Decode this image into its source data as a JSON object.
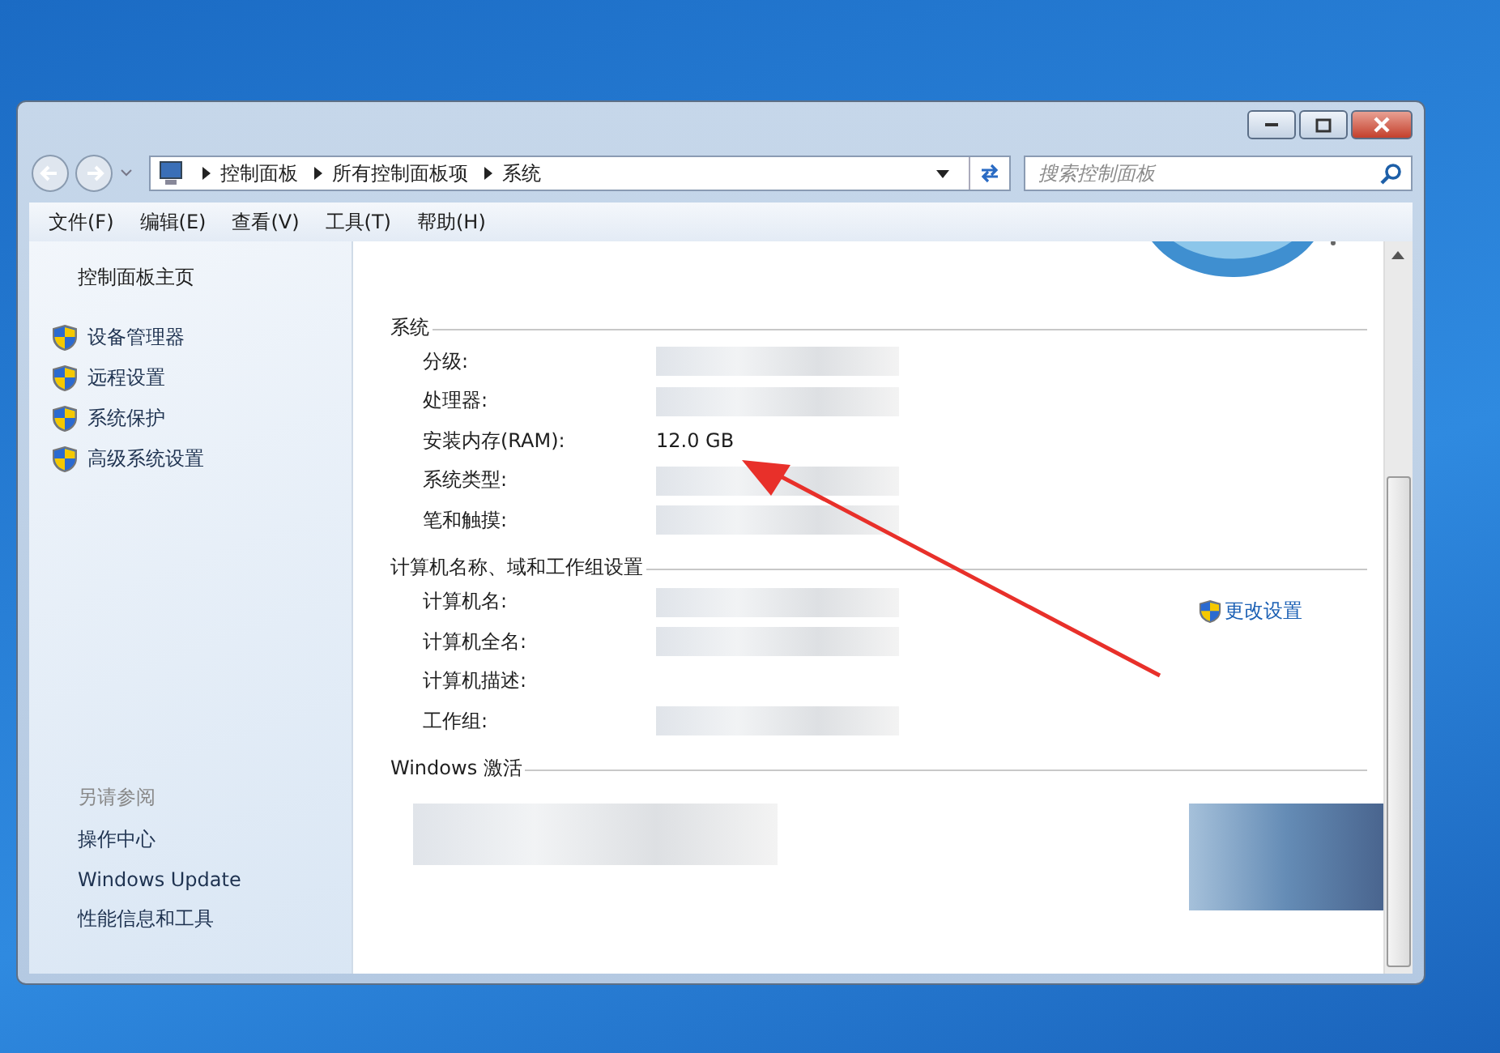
{
  "address": {
    "path": [
      "控制面板",
      "所有控制面板项",
      "系统"
    ]
  },
  "search": {
    "placeholder": "搜索控制面板"
  },
  "menu": [
    "文件(F)",
    "编辑(E)",
    "查看(V)",
    "工具(T)",
    "帮助(H)"
  ],
  "sidebar": {
    "home": "控制面板主页",
    "links": [
      {
        "label": "设备管理器",
        "kind": "shield"
      },
      {
        "label": "远程设置",
        "kind": "shield"
      },
      {
        "label": "系统保护",
        "kind": "shield"
      },
      {
        "label": "高级系统设置",
        "kind": "shield"
      }
    ],
    "see_also": {
      "heading": "另请参阅",
      "items": [
        "操作中心",
        "Windows Update",
        "性能信息和工具"
      ]
    }
  },
  "sections": [
    {
      "title": "系统",
      "rows": [
        {
          "label": "分级:",
          "redacted": true
        },
        {
          "label": "处理器:",
          "redacted": true
        },
        {
          "label": "安装内存(RAM):",
          "value": "12.0 GB"
        },
        {
          "label": "系统类型:",
          "redacted": true
        },
        {
          "label": "笔和触摸:",
          "redacted": true
        }
      ]
    },
    {
      "title": "计算机名称、域和工作组设置",
      "link": "更改设置",
      "rows": [
        {
          "label": "计算机名:",
          "redacted": true
        },
        {
          "label": "计算机全名:",
          "redacted": true
        },
        {
          "label": "计算机描述:"
        },
        {
          "label": "工作组:",
          "redacted": true
        }
      ]
    },
    {
      "title": "Windows 激活",
      "redacted": true
    }
  ]
}
